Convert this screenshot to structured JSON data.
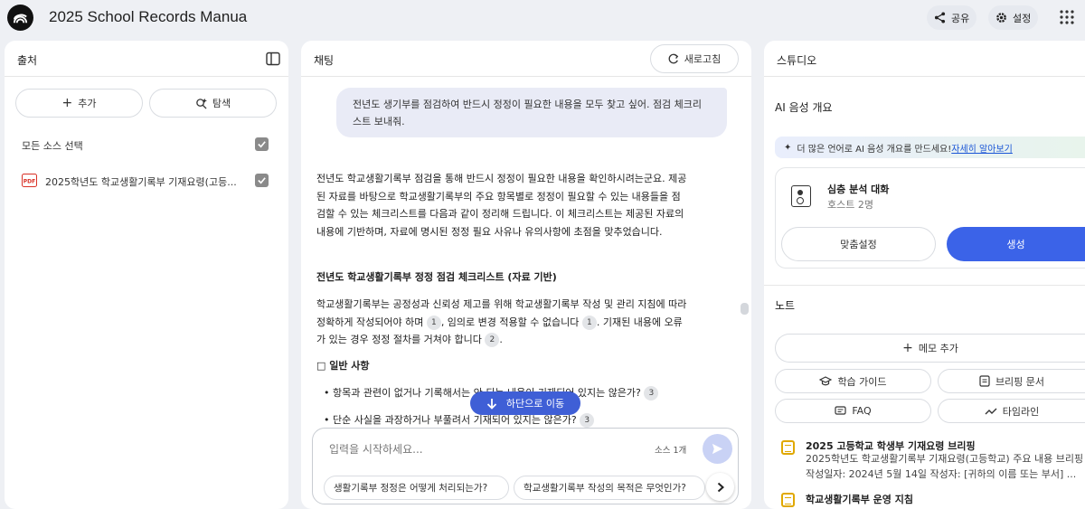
{
  "app": {
    "title": "2025 School Records Manua"
  },
  "topbar": {
    "share_label": "공유",
    "settings_label": "설정"
  },
  "sources": {
    "title": "출처",
    "add_label": "추가",
    "explore_label": "탐색",
    "select_all_label": "모든 소스 선택",
    "items": [
      {
        "label": "2025학년도 학교생활기록부 기재요령(고등...",
        "type": "PDF"
      }
    ]
  },
  "chat": {
    "title": "채팅",
    "refresh_label": "새로고침",
    "user_message": "전년도 생기부를 점검하여 반드시 정정이 필요한 내용을 모두 찾고 싶어. 점검 체크리스트 보내줘.",
    "response_intro": "전년도 학교생활기록부 점검을 통해 반드시 정정이 필요한 내용을 확인하시려는군요. 제공된 자료를 바탕으로 학교생활기록부의 주요 항목별로 정정이 필요할 수 있는 내용들을 점검할 수 있는 체크리스트를 다음과 같이 정리해 드립니다. 이 체크리스트는 제공된 자료의 내용에 기반하며, 자료에 명시된 정정 필요 사유나 유의사항에 초점을 맞추었습니다.",
    "response_heading": "전년도 학교생활기록부 정정 점검 체크리스트 (자료 기반)",
    "para2_a": "학교생활기록부는 공정성과 신뢰성 제고를 위해 학교생활기록부 작성 및 관리 지침에 따라 정확하게 작성되어야 하며",
    "para2_b": ", 임의로 변경 적용할 수 없습니다",
    "para2_c": ". 기재된 내용에 오류가 있는 경우 정정 절차를 거쳐야 합니다",
    "para2_d": ".",
    "cite_1": "1",
    "cite_2": "2",
    "cite_3": "3",
    "section_heading": "□ 일반 사항",
    "bullet_1": "• 항목과 관련이 없거나 기록해서는 안 되는 내용이 기재되어 있지는 않은가?",
    "bullet_2": "• 단순 사실을 과장하거나 부풀려서 기재되어 있지는 않은가?",
    "scroll_down_label": "하단으로 이동",
    "input_placeholder": "입력을 시작하세요...",
    "source_count": "소스 1개",
    "suggestions": [
      "생활기록부 정정은 어떻게 처리되는가?",
      "학교생활기록부 작성의 목적은 무엇인가?"
    ]
  },
  "studio": {
    "title": "스튜디오",
    "audio_title": "AI 음성 개요",
    "banner_text": "더 많은 언어로 AI 음성 개요를 만드세요!",
    "banner_link": "자세히 알아보기",
    "card_title": "심층 분석 대화",
    "card_subtitle": "호스트 2명",
    "customize_label": "맞춤설정",
    "generate_label": "생성",
    "notes_title": "노트",
    "add_note_label": "메모 추가",
    "study_guide_label": "학습 가이드",
    "briefing_label": "브리핑 문서",
    "faq_label": "FAQ",
    "timeline_label": "타임라인",
    "notes": [
      {
        "title": "2025 고등학교 학생부 기재요령 브리핑",
        "desc": "2025학년도 학교생활기록부 기재요령(고등학교) 주요 내용 브리핑 작성일자: 2024년 5월 14일 작성자: [귀하의 이름 또는 부서] ..."
      },
      {
        "title": "학교생활기록부 운영 지침",
        "desc": ""
      }
    ]
  },
  "colors": {
    "accent": "#3b63e8",
    "background": "#eef0f4"
  }
}
